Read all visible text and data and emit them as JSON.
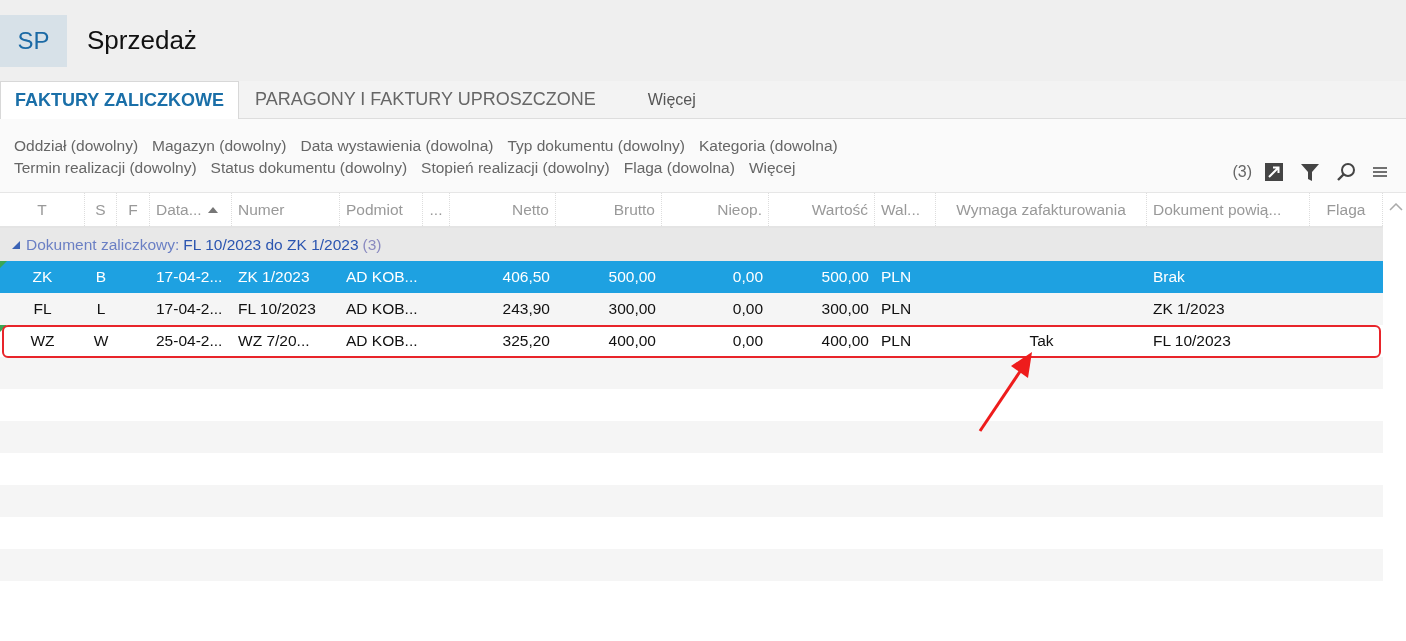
{
  "app": {
    "badge": "SP",
    "title": "Sprzedaż"
  },
  "tabs": [
    {
      "label": "FAKTURY ZALICZKOWE",
      "selected": true
    },
    {
      "label": "PARAGONY I FAKTURY UPROSZCZONE",
      "selected": false
    },
    {
      "label": "Więcej",
      "selected": false,
      "kind": "more"
    }
  ],
  "filters": [
    [
      "Oddział (dowolny)",
      "Magazyn (dowolny)",
      "Data wystawienia (dowolna)",
      "Typ dokumentu (dowolny)",
      "Kategoria (dowolna)"
    ],
    [
      "Termin realizacji (dowolny)",
      "Status dokumentu (dowolny)",
      "Stopień realizacji (dowolny)",
      "Flaga (dowolna)",
      "Więcej"
    ]
  ],
  "toolbar": {
    "count": "(3)"
  },
  "table": {
    "columns": [
      {
        "label": "T",
        "sorted_ascending": false
      },
      {
        "label": "S",
        "sorted_ascending": false
      },
      {
        "label": "F",
        "sorted_ascending": false
      },
      {
        "label": "Data...",
        "sorted_ascending": true
      },
      {
        "label": "Numer",
        "sorted_ascending": false
      },
      {
        "label": "Podmiot",
        "sorted_ascending": false
      },
      {
        "label": "...",
        "sorted_ascending": false
      },
      {
        "label": "Netto",
        "sorted_ascending": false
      },
      {
        "label": "Brutto",
        "sorted_ascending": false
      },
      {
        "label": "Nieop.",
        "sorted_ascending": false
      },
      {
        "label": "Wartość",
        "sorted_ascending": false
      },
      {
        "label": "Wal...",
        "sorted_ascending": false
      },
      {
        "label": "Wymaga zafakturowania",
        "sorted_ascending": false
      },
      {
        "label": "Dokument powią...",
        "sorted_ascending": false
      },
      {
        "label": "Flaga",
        "sorted_ascending": false
      }
    ],
    "group": {
      "expanded": true,
      "label": "Dokument zaliczkowy:",
      "value": "FL 10/2023 do ZK 1/2023",
      "count": "(3)"
    },
    "rows": [
      {
        "selected": true,
        "corner_mark": true,
        "highlighted": false,
        "cells": [
          "ZK",
          "B",
          null,
          "17-04-2...",
          "ZK 1/2023",
          "AD KOB...",
          null,
          "406,50",
          "500,00",
          "0,00",
          "500,00",
          "PLN",
          null,
          "Brak",
          null
        ]
      },
      {
        "selected": false,
        "corner_mark": false,
        "highlighted": false,
        "cells": [
          "FL",
          "L",
          null,
          "17-04-2...",
          "FL 10/2023",
          "AD KOB...",
          null,
          "243,90",
          "300,00",
          "0,00",
          "300,00",
          "PLN",
          null,
          "ZK 1/2023",
          null
        ]
      },
      {
        "selected": false,
        "corner_mark": true,
        "highlighted": true,
        "cells": [
          "WZ",
          "W",
          null,
          "25-04-2...",
          "WZ 7/20...",
          "AD KOB...",
          null,
          "325,20",
          "400,00",
          "0,00",
          "400,00",
          "PLN",
          "Tak",
          "FL 10/2023",
          null
        ]
      }
    ]
  }
}
